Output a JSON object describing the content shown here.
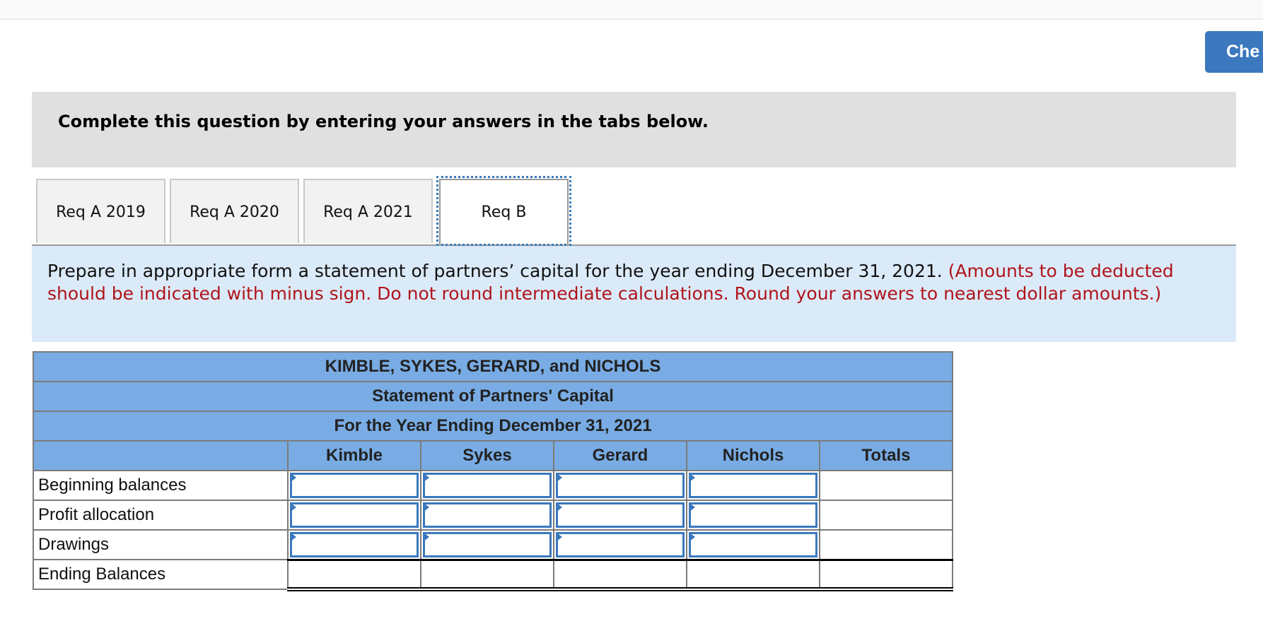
{
  "header": {
    "check_button_label": "Che"
  },
  "question_box": {
    "title": "Complete this question by entering your answers in the tabs below."
  },
  "tabs": [
    {
      "label": "Req A 2019",
      "active": false
    },
    {
      "label": "Req A 2020",
      "active": false
    },
    {
      "label": "Req A 2021",
      "active": false
    },
    {
      "label": "Req B",
      "active": true
    }
  ],
  "instructions": {
    "main": "Prepare in appropriate form a statement of partners’ capital for the year ending December 31, 2021.",
    "note": "(Amounts to be deducted should be indicated with minus sign. Do not round intermediate calculations. Round your answers to nearest dollar amounts.)"
  },
  "statement": {
    "title_line1": "KIMBLE, SYKES, GERARD, and NICHOLS",
    "title_line2": "Statement of Partners' Capital",
    "title_line3": "For the Year Ending December 31, 2021",
    "columns": [
      "Kimble",
      "Sykes",
      "Gerard",
      "Nichols",
      "Totals"
    ],
    "rows": [
      {
        "label": "Beginning balances",
        "values": [
          "",
          "",
          "",
          "",
          ""
        ]
      },
      {
        "label": "Profit allocation",
        "values": [
          "",
          "",
          "",
          "",
          ""
        ]
      },
      {
        "label": "Drawings",
        "values": [
          "",
          "",
          "",
          "",
          ""
        ]
      },
      {
        "label": "Ending Balances",
        "values": [
          "",
          "",
          "",
          "",
          ""
        ]
      }
    ]
  },
  "colors": {
    "accent": "#3b78bd",
    "table_header": "#79ace4",
    "instruction_bg": "#dbeaf8",
    "note_red": "#b0141b"
  }
}
